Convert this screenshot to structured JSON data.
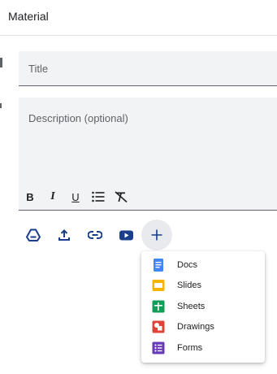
{
  "header": {
    "title": "Material"
  },
  "title_field": {
    "placeholder": "Title",
    "value": ""
  },
  "description_field": {
    "placeholder": "Description (optional)",
    "value": ""
  },
  "format_toolbar": {
    "bold_label": "B",
    "italic_label": "I",
    "underline_label": "U",
    "icons": [
      "bulleted-list-icon",
      "clear-formatting-icon"
    ]
  },
  "attachments": {
    "icons": [
      "google-drive-icon",
      "upload-icon",
      "link-icon",
      "youtube-icon",
      "add-icon"
    ],
    "accent_color": "#1a3e8c"
  },
  "create_menu": {
    "items": [
      {
        "label": "Docs",
        "icon": "docs-icon",
        "color": "#4285f4"
      },
      {
        "label": "Slides",
        "icon": "slides-icon",
        "color": "#f4b400"
      },
      {
        "label": "Sheets",
        "icon": "sheets-icon",
        "color": "#0f9d58"
      },
      {
        "label": "Drawings",
        "icon": "drawings-icon",
        "color": "#db4437"
      },
      {
        "label": "Forms",
        "icon": "forms-icon",
        "color": "#673ab7"
      }
    ]
  }
}
